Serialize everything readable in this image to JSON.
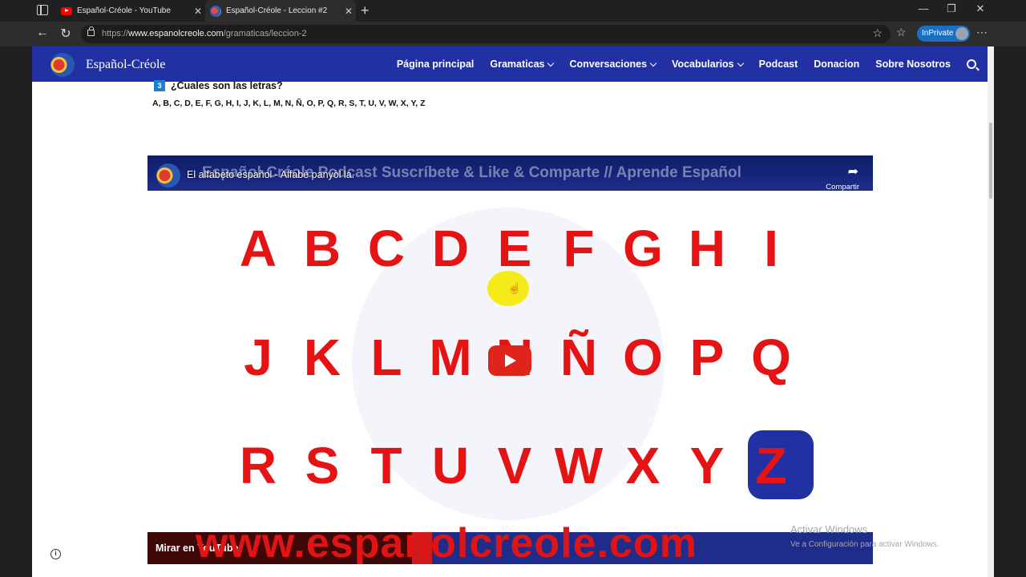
{
  "browser": {
    "tabs": [
      {
        "title": "Español-Créole - YouTube",
        "icon": "youtube-favicon"
      },
      {
        "title": "Español-Créole - Leccion #2",
        "icon": "site-favicon"
      }
    ],
    "url_prefix": "https://",
    "url_host": "www.espanolcreole.com",
    "url_path": "/gramaticas/leccion-2",
    "inprivate_label": "InPrivate"
  },
  "site": {
    "brand": "Español-Créole",
    "nav": [
      {
        "label": "Página principal"
      },
      {
        "label": "Gramaticas",
        "dropdown": true
      },
      {
        "label": "Conversaciones",
        "dropdown": true
      },
      {
        "label": "Vocabularios",
        "dropdown": true
      },
      {
        "label": "Podcast"
      },
      {
        "label": "Donacion"
      },
      {
        "label": "Sobre Nosotros"
      }
    ]
  },
  "content": {
    "section_number": "3",
    "section_title": "¿Cuales son las letras?",
    "letters_line": "A, B, C, D, E, F, G, H, I, J, K, L, M, N, Ñ, O, P, Q, R, S, T, U, V, W, X, Y, Z"
  },
  "video": {
    "banner": "Español-Créole Podcast   Suscríbete & Like & Comparte // Aprende Español",
    "title": "El alfabeto español - Alfabè panyòl la.",
    "share_label": "Compartir",
    "rows": [
      [
        "A",
        "B",
        "C",
        "D",
        "E",
        "F",
        "G",
        "H",
        "I"
      ],
      [
        "J",
        "K",
        "L",
        "M",
        "N",
        "Ñ",
        "O",
        "P",
        "Q"
      ],
      [
        "R",
        "S",
        "T",
        "U",
        "V",
        "W",
        "X",
        "Y",
        "Z"
      ]
    ],
    "watch_on": "Mirar en",
    "site_url": "www.espanolcreole.com",
    "letter_color": "#e51313",
    "accent_color": "#2130a3"
  },
  "windows_watermark": {
    "line1": "Activar Windows",
    "line2": "Ve a Configuración para activar Windows."
  }
}
